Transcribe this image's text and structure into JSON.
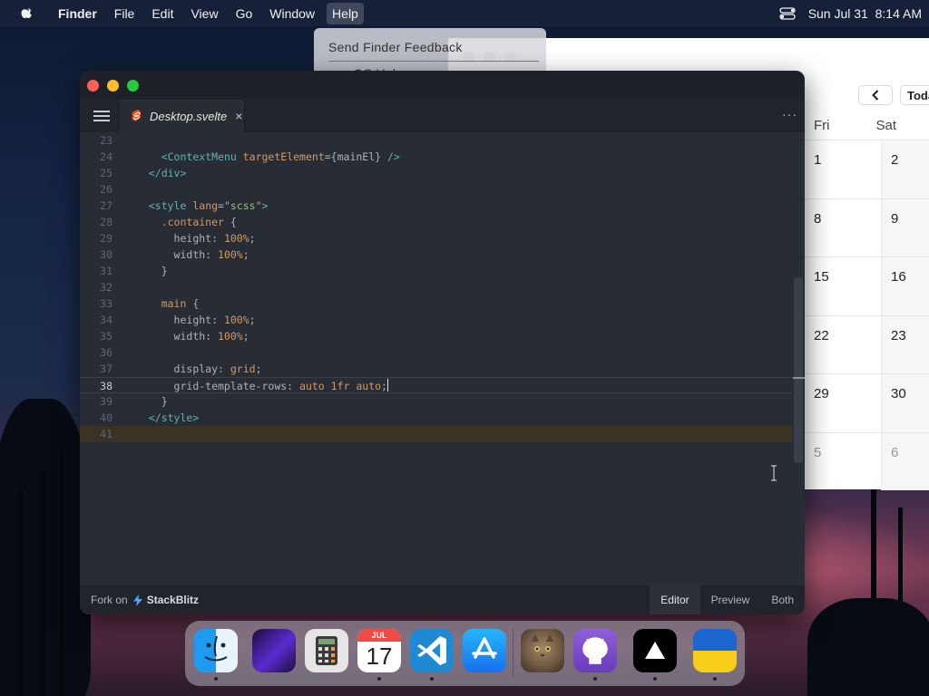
{
  "menubar": {
    "app": "Finder",
    "items": [
      "File",
      "Edit",
      "View",
      "Go",
      "Window",
      "Help"
    ],
    "datetime": "Sun Jul 31  8:14 AM"
  },
  "help_menu": {
    "items": [
      "Send Finder Feedback",
      "macOS Help"
    ]
  },
  "calendar": {
    "today_label": "Toda",
    "day_headers": [
      "Fri",
      "Sat"
    ],
    "rows": [
      [
        "1",
        "2"
      ],
      [
        "8",
        "9"
      ],
      [
        "15",
        "16"
      ],
      [
        "22",
        "23"
      ],
      [
        "29",
        "30"
      ],
      [
        "5",
        "6"
      ]
    ]
  },
  "editor": {
    "tab_name": "Desktop.svelte",
    "tab_close": "×",
    "more": "···",
    "current_line": "38",
    "code": [
      {
        "n": "23",
        "t": []
      },
      {
        "n": "24",
        "t": [
          [
            "txt",
            "    "
          ],
          [
            "tag",
            "<ContextMenu"
          ],
          [
            "txt",
            " "
          ],
          [
            "attr",
            "targetElement"
          ],
          [
            "txt",
            "={mainEl} "
          ],
          [
            "tag",
            "/>"
          ]
        ]
      },
      {
        "n": "25",
        "t": [
          [
            "txt",
            "  "
          ],
          [
            "tag",
            "</div>"
          ]
        ]
      },
      {
        "n": "26",
        "t": []
      },
      {
        "n": "27",
        "t": [
          [
            "txt",
            "  "
          ],
          [
            "tag",
            "<style"
          ],
          [
            "txt",
            " "
          ],
          [
            "attr",
            "lang"
          ],
          [
            "txt",
            "="
          ],
          [
            "str",
            "\"scss\""
          ],
          [
            "tag",
            ">"
          ]
        ]
      },
      {
        "n": "28",
        "t": [
          [
            "txt",
            "    "
          ],
          [
            "attr",
            ".container"
          ],
          [
            "txt",
            " {"
          ]
        ]
      },
      {
        "n": "29",
        "t": [
          [
            "txt",
            "      "
          ],
          [
            "prop",
            "height"
          ],
          [
            "txt",
            ": "
          ],
          [
            "val",
            "100%"
          ],
          [
            "txt",
            ";"
          ]
        ]
      },
      {
        "n": "30",
        "t": [
          [
            "txt",
            "      "
          ],
          [
            "prop",
            "width"
          ],
          [
            "txt",
            ": "
          ],
          [
            "val",
            "100%"
          ],
          [
            "txt",
            ";"
          ]
        ]
      },
      {
        "n": "31",
        "t": [
          [
            "txt",
            "    }"
          ]
        ]
      },
      {
        "n": "32",
        "t": []
      },
      {
        "n": "33",
        "t": [
          [
            "txt",
            "    "
          ],
          [
            "attr",
            "main"
          ],
          [
            "txt",
            " {"
          ]
        ]
      },
      {
        "n": "34",
        "t": [
          [
            "txt",
            "      "
          ],
          [
            "prop",
            "height"
          ],
          [
            "txt",
            ": "
          ],
          [
            "val",
            "100%"
          ],
          [
            "txt",
            ";"
          ]
        ]
      },
      {
        "n": "35",
        "t": [
          [
            "txt",
            "      "
          ],
          [
            "prop",
            "width"
          ],
          [
            "txt",
            ": "
          ],
          [
            "val",
            "100%"
          ],
          [
            "txt",
            ";"
          ]
        ]
      },
      {
        "n": "36",
        "t": []
      },
      {
        "n": "37",
        "t": [
          [
            "txt",
            "      "
          ],
          [
            "prop",
            "display"
          ],
          [
            "txt",
            ": "
          ],
          [
            "val",
            "grid"
          ],
          [
            "txt",
            ";"
          ]
        ]
      },
      {
        "n": "38",
        "t": [
          [
            "txt",
            "      "
          ],
          [
            "prop",
            "grid-template-rows"
          ],
          [
            "txt",
            ": "
          ],
          [
            "val",
            "auto 1fr auto"
          ],
          [
            "txt",
            ";"
          ]
        ]
      },
      {
        "n": "39",
        "t": [
          [
            "txt",
            "    }"
          ]
        ]
      },
      {
        "n": "40",
        "t": [
          [
            "txt",
            "  "
          ],
          [
            "tag",
            "</style>"
          ]
        ]
      },
      {
        "n": "41",
        "t": []
      }
    ]
  },
  "statusbar": {
    "fork_label": "Fork on",
    "brand": "StackBlitz",
    "views": [
      "Editor",
      "Preview",
      "Both"
    ],
    "active_view": "Editor"
  },
  "dock": {
    "calendar_month": "JUL",
    "calendar_day": "17",
    "apps": [
      "finder",
      "launchpad",
      "calculator",
      "calendar",
      "vscode",
      "app-store",
      "photo-cat",
      "github-desktop",
      "vercel",
      "ukraine-flag"
    ]
  },
  "colors": {
    "editor_bg": "#282c34",
    "accent_red": "#fe5f57",
    "accent_yellow": "#febc2e",
    "accent_green": "#28c840"
  }
}
